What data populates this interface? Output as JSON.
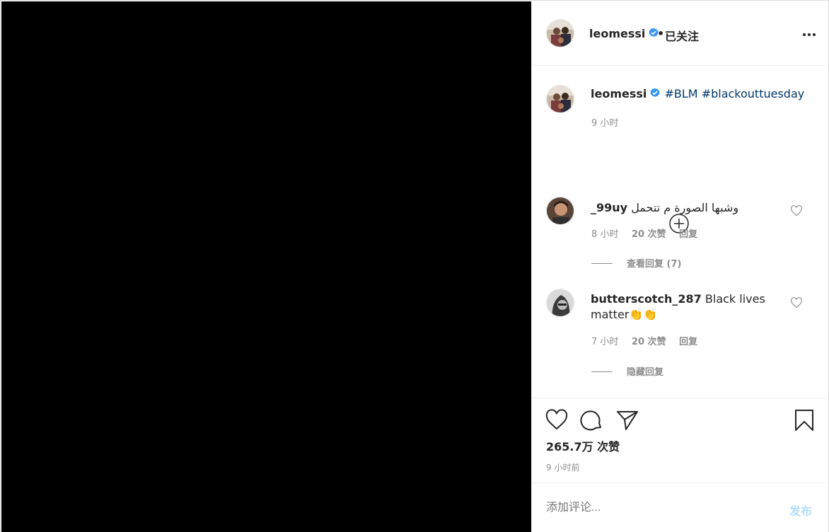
{
  "header": {
    "username": "leomessi",
    "separator": "•",
    "follow_label": "已关注"
  },
  "caption": {
    "username": "leomessi",
    "hashtags": [
      "#BLM",
      "#blackouttuesday"
    ],
    "time": "9 小时"
  },
  "comments": [
    {
      "username": "_99uy",
      "text": "وشبها الصورة م تتحمل",
      "time": "8 小时",
      "likes": "20 次赞",
      "reply_label": "回复",
      "replies_toggle": "查看回复 (7)"
    },
    {
      "username": "butterscotch_287",
      "text": "Black lives matter👏👏",
      "time": "7 小时",
      "likes": "20 次赞",
      "reply_label": "回复",
      "replies_toggle": "隐藏回复"
    }
  ],
  "stats": {
    "likes": "265.7万 次赞",
    "posted_ago": "9 小时前"
  },
  "comment_box": {
    "placeholder": "添加评论...",
    "post_label": "发布"
  },
  "colors": {
    "verified_blue": "#3897f0",
    "hashtag": "#00376b",
    "post_disabled": "#b2dffc"
  }
}
